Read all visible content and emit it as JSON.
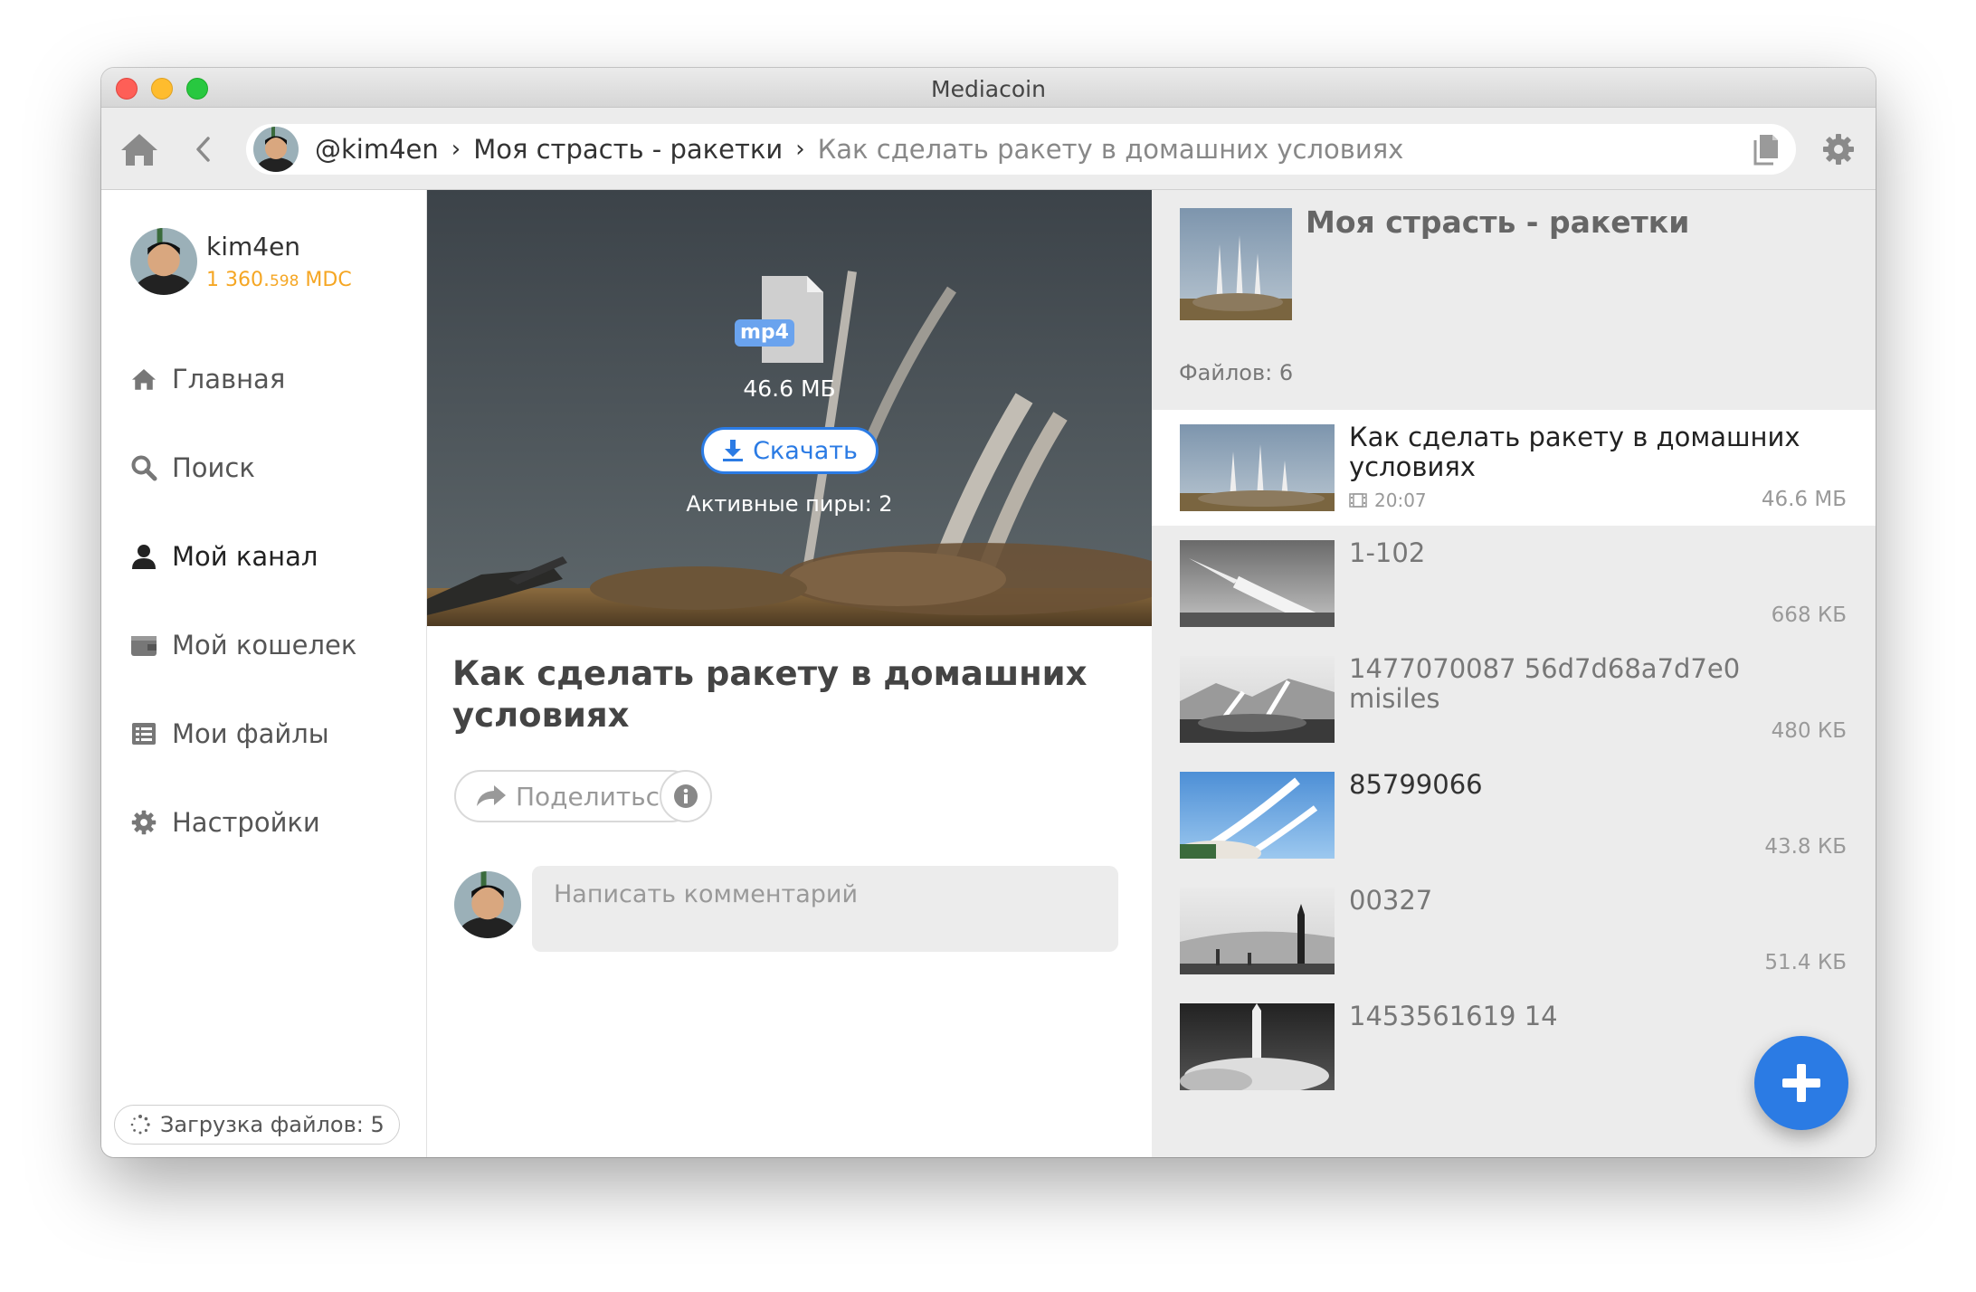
{
  "window": {
    "title": "Mediacoin"
  },
  "breadcrumb": {
    "user": "@kim4en",
    "channel": "Моя страсть - ракетки",
    "item": "Как сделать ракету в домашних условиях"
  },
  "profile": {
    "name": "kim4en",
    "balance_main": "1 360.",
    "balance_fraction": "598",
    "balance_unit": " MDC"
  },
  "nav": [
    {
      "label": "Главная",
      "icon": "home-icon"
    },
    {
      "label": "Поиск",
      "icon": "search-icon"
    },
    {
      "label": "Мой канал",
      "icon": "user-icon"
    },
    {
      "label": "Мой кошелек",
      "icon": "wallet-icon"
    },
    {
      "label": "Мои файлы",
      "icon": "list-icon"
    },
    {
      "label": "Настройки",
      "icon": "gear-icon"
    }
  ],
  "uploads": {
    "label": "Загрузка файлов: 5"
  },
  "media": {
    "file_type": "mp4",
    "file_size": "46.6 МБ",
    "download_label": "Скачать",
    "peers": "Активные пиры: 2",
    "title": "Как сделать ракету в домашних условиях",
    "share_label": "Поделиться",
    "comment_placeholder": "Написать комментарий"
  },
  "channel": {
    "title": "Моя страсть - ракетки",
    "files_count": "Файлов: 6",
    "files": [
      {
        "name": "Как сделать ракету в домашних условиях",
        "time": "20:07",
        "size": "46.6 МБ",
        "selected": true
      },
      {
        "name": "1-102",
        "size": "668 КБ"
      },
      {
        "name": "1477070087 56d7d68a7d7e0 misiles",
        "size": "480 КБ"
      },
      {
        "name": "85799066",
        "size": "43.8 КБ"
      },
      {
        "name": "00327",
        "size": "51.4 КБ"
      },
      {
        "name": "1453561619 14",
        "size": ""
      }
    ]
  },
  "colors": {
    "accent": "#2b7be4",
    "balance": "#f5a623"
  }
}
